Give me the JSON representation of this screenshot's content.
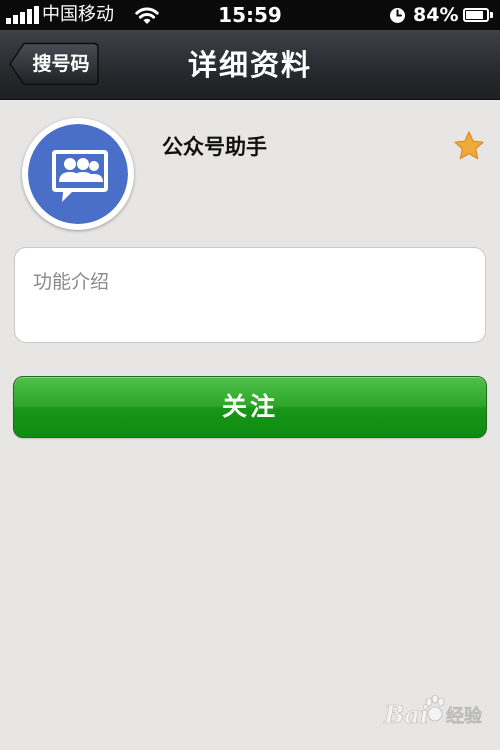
{
  "status_bar": {
    "carrier": "中国移动",
    "time": "15:59",
    "battery_percent": "84%",
    "battery_level": 0.84,
    "signal_strength_bars": 5,
    "icons": [
      "signal-icon",
      "wifi-icon",
      "clock-icon",
      "battery-icon"
    ]
  },
  "nav": {
    "back_label": "搜号码",
    "title": "详细资料"
  },
  "profile": {
    "name": "公众号助手",
    "avatar_icon": "group-chat-icon",
    "favorite_icon": "star-icon"
  },
  "intro": {
    "label": "功能介绍"
  },
  "actions": {
    "follow_label": "关注"
  },
  "watermark": {
    "brand_left": "Bai",
    "brand_right": "经验"
  },
  "colors": {
    "status_bar_bg": "#0a0a0a",
    "nav_bar_bg": "#2a2d31",
    "page_bg": "#e7e6e5",
    "follow_button": "#1a961a",
    "star": "#f2a93b",
    "avatar_blue": "#4a6fc9"
  }
}
